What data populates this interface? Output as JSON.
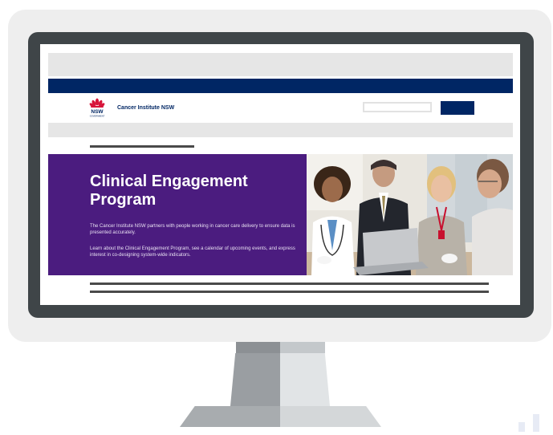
{
  "header": {
    "logo_text": "NSW",
    "logo_subtext": "GOVERNMENT",
    "brand": "Cancer Institute NSW"
  },
  "search": {
    "placeholder": "",
    "button_label": ""
  },
  "hero": {
    "title": "Clinical Engagement Program",
    "paragraph1": "The Cancer Institute NSW partners with people working in cancer care delivery to ensure data is presented accurately.",
    "paragraph2": "Learn about the Clinical Engagement Program, see a calendar of upcoming events, and express interest  in co-designing system-wide indicators."
  },
  "colors": {
    "navy": "#002664",
    "purple": "#4b1c7f",
    "waratah_red": "#d7153a"
  },
  "icons": [
    "waratah-logo-icon"
  ]
}
